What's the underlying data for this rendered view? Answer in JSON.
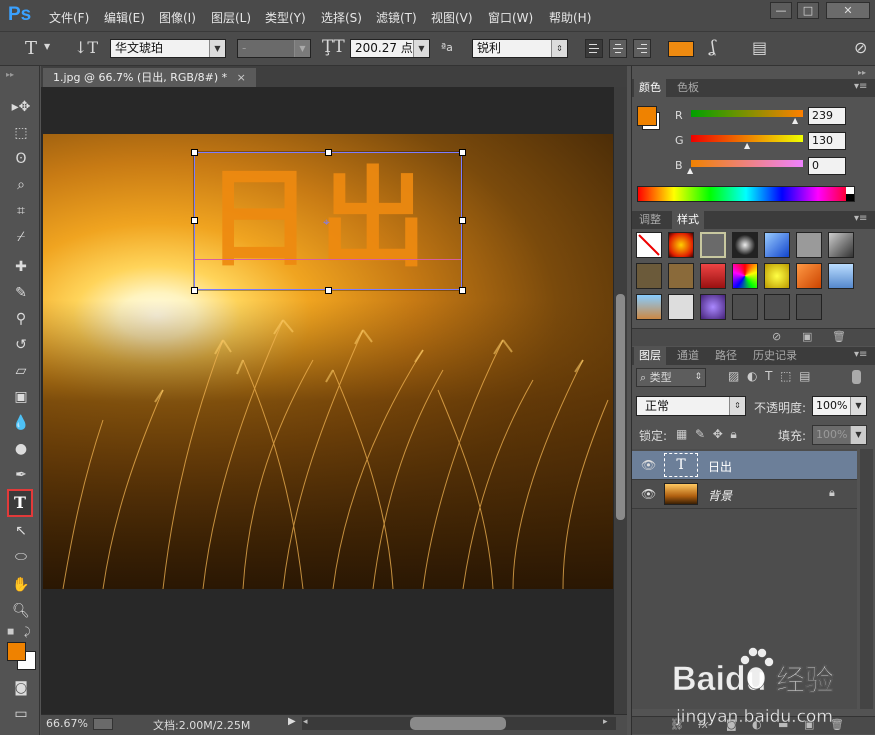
{
  "app": {
    "logo": "Ps"
  },
  "menu": [
    "文件(F)",
    "编辑(E)",
    "图像(I)",
    "图层(L)",
    "类型(Y)",
    "选择(S)",
    "滤镜(T)",
    "视图(V)",
    "窗口(W)",
    "帮助(H)"
  ],
  "window_buttons": {
    "minimize": "—",
    "maximize": "□",
    "close": "✕"
  },
  "options": {
    "font_family": "华文琥珀",
    "font_style": "-",
    "font_size": "200.27 点",
    "aa_label": "ªa",
    "antialias": "锐利",
    "text_color": "#ee8a10"
  },
  "document": {
    "tab_title": "1.jpg @ 66.7% (日出, RGB/8#) *",
    "canvas_text": "日出",
    "text_color": "#ee8a10"
  },
  "status": {
    "zoom": "66.67%",
    "doc_size": "文档:2.00M/2.25M"
  },
  "color_panel": {
    "tabs": [
      "颜色",
      "色板"
    ],
    "channels": [
      {
        "name": "R",
        "value": "239"
      },
      {
        "name": "G",
        "value": "130"
      },
      {
        "name": "B",
        "value": "0"
      }
    ],
    "foreground": "#ef8200"
  },
  "styles_panel": {
    "tabs": [
      "调整",
      "样式"
    ]
  },
  "layers_panel": {
    "tabs": [
      "图层",
      "通道",
      "路径",
      "历史记录"
    ],
    "filter": "类型",
    "blend_mode": "正常",
    "opacity_label": "不透明度:",
    "opacity": "100%",
    "lock_label": "锁定:",
    "fill_label": "填充:",
    "fill": "100%",
    "layers": [
      {
        "name": "日出",
        "type": "T",
        "selected": true
      },
      {
        "name": "背景",
        "type": "image",
        "locked": true
      }
    ]
  },
  "watermark": {
    "brand": "Baidu",
    "brand_cn": "经验",
    "url": "jingyan.baidu.com"
  }
}
